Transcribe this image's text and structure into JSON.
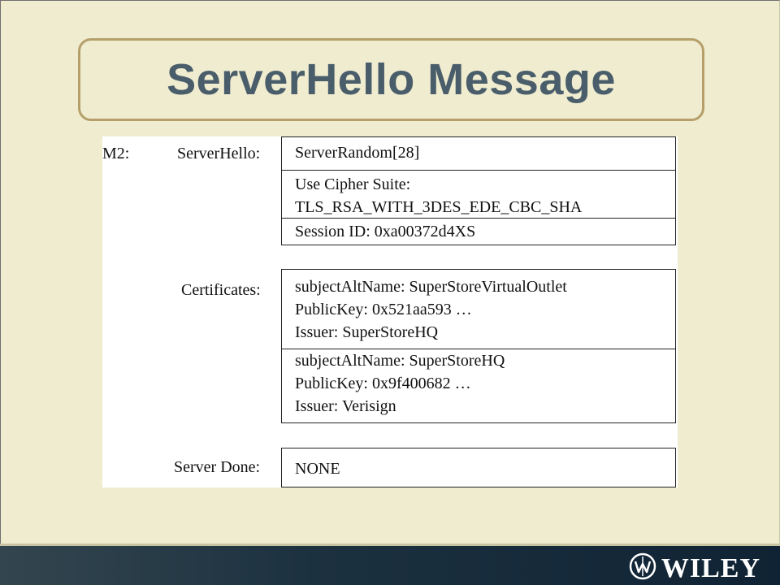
{
  "title": "ServerHello Message",
  "labels": {
    "m2": "M2:",
    "server_hello": "ServerHello:",
    "certificates": "Certificates:",
    "server_done": "Server Done:"
  },
  "server_hello": {
    "random": "ServerRandom[28]",
    "cipher_line1": "Use Cipher Suite:",
    "cipher_line2": "TLS_RSA_WITH_3DES_EDE_CBC_SHA",
    "session_id": "Session ID: 0xa00372d4XS"
  },
  "certificates": [
    {
      "subject": "subjectAltName: SuperStoreVirtualOutlet",
      "public_key": "PublicKey: 0x521aa593 …",
      "issuer": "Issuer: SuperStoreHQ"
    },
    {
      "subject": "subjectAltName: SuperStoreHQ",
      "public_key": "PublicKey: 0x9f400682 …",
      "issuer": "Issuer: Verisign"
    }
  ],
  "server_done": "NONE",
  "footer": {
    "logo_text": "WILEY",
    "logo_icon": "wiley-emblem-icon"
  }
}
